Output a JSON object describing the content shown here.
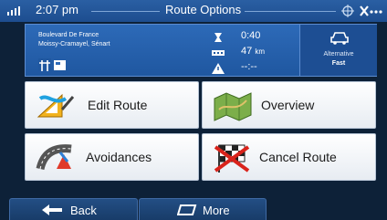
{
  "status_bar": {
    "time": "2:07 pm",
    "title": "Route Options",
    "icons": [
      "signal-icon",
      "gps-icon",
      "bluetooth-icon",
      "menu-dots-icon"
    ]
  },
  "route_info": {
    "address_line1": "Boulevard De France",
    "address_line2": "Moissy-Cramayel, Sénart",
    "duration": "0:40",
    "distance": "47",
    "distance_unit": "km",
    "warning_value": "--:--",
    "alternative_label": "Alternative",
    "alternative_mode": "Fast"
  },
  "tiles": [
    {
      "label": "Edit Route",
      "icon": "edit-route-icon"
    },
    {
      "label": "Overview",
      "icon": "overview-map-icon"
    },
    {
      "label": "Avoidances",
      "icon": "avoidances-icon"
    },
    {
      "label": "Cancel Route",
      "icon": "cancel-route-flag-icon"
    }
  ],
  "bottom_bar": {
    "back_label": "Back",
    "more_label": "More"
  },
  "colors": {
    "status_bar": "#1d4d8f",
    "info_bar": "#2560ab",
    "background": "#0d2138",
    "tile": "#f4f6f9",
    "bottom_button": "#1e4676"
  }
}
